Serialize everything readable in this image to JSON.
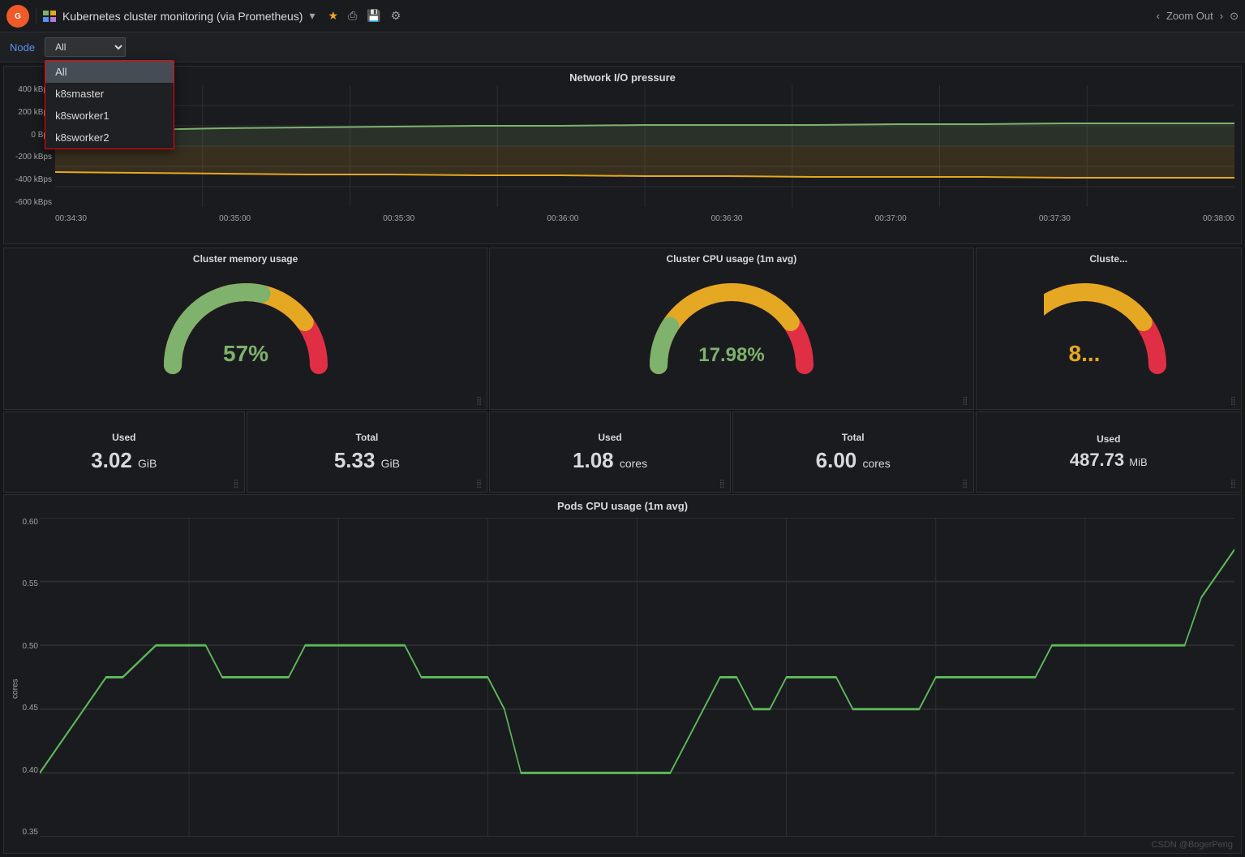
{
  "topnav": {
    "logo": "G",
    "title": "Kubernetes cluster monitoring (via Prometheus)",
    "title_arrow": "▾",
    "icons": [
      "★",
      "⎙",
      "💾",
      "⚙"
    ],
    "zoom_label": "Zoom Out",
    "zoom_left": "‹",
    "zoom_right": "›",
    "zoom_icon": "⊙"
  },
  "filter": {
    "label": "Node",
    "selected": "All",
    "options": [
      "All",
      "k8smaster",
      "k8sworker1",
      "k8sworker2"
    ]
  },
  "network_panel": {
    "title": "Network I/O pressure",
    "y_labels": [
      "400 kBps",
      "200 kBps",
      "0 Bps",
      "-200 kBps",
      "-400 kBps",
      "-600 kBps"
    ],
    "x_labels": [
      "00:34:30",
      "00:35:00",
      "00:35:30",
      "00:36:00",
      "00:36:30",
      "00:37:00",
      "00:37:30",
      "00:38:00"
    ]
  },
  "gauges": [
    {
      "title": "Cluster memory usage",
      "value": "57%",
      "color": "#7eb26d",
      "green_end": 0.57,
      "panel_id": "memory"
    },
    {
      "title": "Cluster CPU usage (1m avg)",
      "value": "17.98%",
      "color": "#7eb26d",
      "green_end": 0.18,
      "panel_id": "cpu"
    },
    {
      "title": "Cluste...",
      "value": "8...",
      "color": "#e5a823",
      "green_end": 0.8,
      "panel_id": "partial"
    }
  ],
  "stats": [
    {
      "label": "Used",
      "value": "3.02",
      "unit": " GiB",
      "panel": "memory-used"
    },
    {
      "label": "Total",
      "value": "5.33",
      "unit": " GiB",
      "panel": "memory-total"
    },
    {
      "label": "Used",
      "value": "1.08",
      "unit": " cores",
      "panel": "cpu-used"
    },
    {
      "label": "Total",
      "value": "6.00",
      "unit": " cores",
      "panel": "cpu-total"
    },
    {
      "label": "Used",
      "value": "487.73",
      "unit": " MiB",
      "panel": "fs-used"
    }
  ],
  "pods_panel": {
    "title": "Pods CPU usage (1m avg)",
    "y_labels": [
      "0.60",
      "0.55",
      "0.50",
      "0.45",
      "0.40",
      "0.35"
    ],
    "y_axis_label": "cores",
    "watermark": "CSDN @BogerPeng"
  }
}
